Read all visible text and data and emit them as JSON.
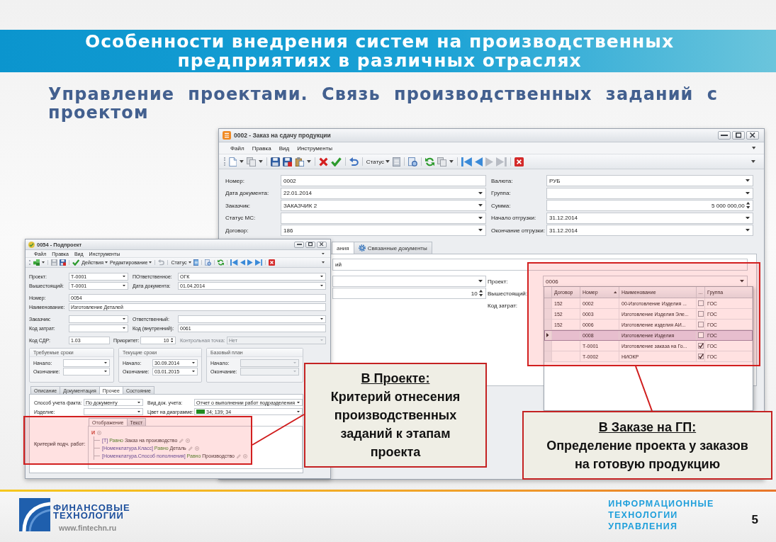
{
  "slide": {
    "title": "Особенности внедрения систем на производственных предприятиях в различных отраслях",
    "subtitle": "Управление проектами. Связь производственных заданий с проектом"
  },
  "order_window": {
    "title": "0002 - Заказ на сдачу продукции",
    "menu": [
      "Файл",
      "Правка",
      "Вид",
      "Инструменты"
    ],
    "toolbar": {
      "status_label": "Статус"
    },
    "fields_left": [
      {
        "label": "Номер:",
        "value": "0002",
        "kind": "text"
      },
      {
        "label": "Дата документа:",
        "value": "22.01.2014",
        "kind": "dropdown"
      },
      {
        "label": "Заказчик:",
        "value": "ЗАКАЗЧИК 2",
        "kind": "dropdown"
      },
      {
        "label": "Статус МС:",
        "kind": "dropdown"
      },
      {
        "label": "Договор:",
        "value": "186",
        "kind": "dropdown"
      }
    ],
    "fields_right": [
      {
        "label": "Валюта:",
        "value": "РУБ",
        "kind": "dropdown"
      },
      {
        "label": "Группа:",
        "kind": "dropdown"
      },
      {
        "label": "Сумма:",
        "value": "5 000 000,00",
        "kind": "spin"
      },
      {
        "label": "Начало отгрузки:",
        "value": "31.12.2014",
        "kind": "dropdown"
      },
      {
        "label": "Окончание отгрузки:",
        "value": "31.12.2014",
        "kind": "dropdown"
      }
    ],
    "tabs": [
      {
        "label": "ания",
        "selected": true
      },
      {
        "label": "Связанные документы",
        "selected": false
      }
    ],
    "tab_panel": {
      "wide_field": {
        "value": "ий",
        "kind": "text"
      },
      "left_fields": [
        {
          "kind": "dropdown"
        },
        {
          "value": "10",
          "kind": "spin"
        }
      ],
      "right_fields": [
        {
          "label": "Проект:",
          "value": "0006",
          "kind": "dropdown"
        },
        {
          "label": "Вышестоящий:"
        },
        {
          "label": "Код затрат:"
        }
      ]
    },
    "lookup": {
      "columns": [
        {
          "label": "Договор",
          "sorted": false
        },
        {
          "label": "Номер",
          "sorted": true
        },
        {
          "label": "Наименование",
          "sorted": false
        },
        {
          "label": "...",
          "sorted": false
        },
        {
          "label": "Группа",
          "sorted": false
        }
      ],
      "rows": [
        {
          "contract": "152",
          "number": "0002",
          "name": "00-Изготовление Изделия ...",
          "checked": false,
          "group": "ГОС",
          "selected": false
        },
        {
          "contract": "152",
          "number": "0003",
          "name": "Изготовление Изделия Эле...",
          "checked": false,
          "group": "ГОС",
          "selected": false
        },
        {
          "contract": "152",
          "number": "0006",
          "name": "Изготовление изделия АИ...",
          "checked": false,
          "group": "ГОС",
          "selected": false
        },
        {
          "number": "0008",
          "name": "Изготовление Изделия",
          "checked": false,
          "group": "ГОС",
          "selected": true
        },
        {
          "number": "Т-0001",
          "name": "Изготовление заказа на Го...",
          "checked": true,
          "group": "ГОС",
          "selected": false
        },
        {
          "number": "Т-0002",
          "name": "НИОКР",
          "checked": true,
          "group": "ГОС",
          "selected": false
        }
      ]
    }
  },
  "project_window": {
    "title": "0054 - Подпроект",
    "menu": [
      "Файл",
      "Правка",
      "Вид",
      "Инструменты"
    ],
    "toolbar": {
      "actions_label": "Действия",
      "edit_label": "Редактирование",
      "status_label": "Статус"
    },
    "header_rows": [
      [
        {
          "label": "Проект:",
          "value": "Т-0001",
          "kind": "dropdown",
          "disabled": false
        },
        {
          "label": "ПОтветственное:",
          "value": "ОГК",
          "kind": "dropdown",
          "disabled": false
        }
      ],
      [
        {
          "label": "Вышестоящий:",
          "value": "Т-0001",
          "kind": "dropdown",
          "disabled": false
        },
        {
          "label": "Дата документа:",
          "value": "01.04.2014",
          "kind": "dropdown",
          "disabled": false
        }
      ],
      [
        {
          "label": "Номер:",
          "value": "0054",
          "kind": "text",
          "disabled": false
        }
      ],
      [
        {
          "label": "Наименование:",
          "value": "Изготовление Деталей",
          "kind": "text",
          "disabled": false
        }
      ],
      [
        {
          "label": "Заказчик:",
          "kind": "dropdown",
          "disabled": false
        },
        {
          "label": "Ответственный:",
          "kind": "dropdown",
          "disabled": false
        }
      ],
      [
        {
          "label": "Код затрат:",
          "kind": "dropdown",
          "disabled": false
        },
        {
          "label": "Код (внутренний):",
          "value": "0061",
          "kind": "text",
          "disabled": false
        }
      ],
      [
        {
          "label": "Код СДР:",
          "value": "1.03",
          "kind": "text",
          "disabled": false
        },
        {
          "label": "Приоритет:",
          "value": "10",
          "kind": "spin",
          "disabled": false
        },
        {
          "label": "Контрольная точка:",
          "value": "Нет",
          "kind": "dropdown",
          "disabled": true
        }
      ]
    ],
    "date_groups": [
      {
        "title": "Требуемые сроки",
        "fields": [
          {
            "label": "Начало:",
            "kind": "dropdown",
            "disabled": false
          },
          {
            "label": "Окончание:",
            "kind": "dropdown",
            "disabled": false
          }
        ]
      },
      {
        "title": "Текущие сроки",
        "fields": [
          {
            "label": "Начало:",
            "value": "30.09.2014",
            "kind": "dropdown",
            "disabled": false
          },
          {
            "label": "Окончание:",
            "value": "03.01.2015",
            "kind": "dropdown",
            "disabled": false
          }
        ]
      },
      {
        "title": "Базовый план",
        "fields": [
          {
            "label": "Начало:",
            "kind": "dropdown",
            "disabled": true
          },
          {
            "label": "Окончание:",
            "kind": "dropdown",
            "disabled": true
          }
        ]
      }
    ],
    "tabs": [
      {
        "label": "Описание",
        "selected": false
      },
      {
        "label": "Документация",
        "selected": false
      },
      {
        "label": "Прочее",
        "selected": true
      },
      {
        "label": "Состояние",
        "selected": false
      }
    ],
    "tab_panel_rows": [
      [
        {
          "label": "Способ учета факта:",
          "value": "По документу",
          "kind": "dropdown",
          "disabled": false
        },
        {
          "label": "Вид док. учета:",
          "value": "Отчет о выполнении работ подразделения",
          "kind": "dropdown",
          "disabled": false
        }
      ],
      [
        {
          "label": "Изделие:",
          "kind": "dropdown",
          "disabled": false
        },
        {
          "label": "Цвет на диаграмме:",
          "value": "34; 139; 34",
          "kind": "color",
          "color": "#228b22",
          "disabled": false
        }
      ]
    ],
    "criteria": {
      "label": "Критерий подч. работ:",
      "tabs": [
        {
          "label": "Отображение",
          "selected": true
        },
        {
          "label": "Текст",
          "selected": false
        }
      ],
      "tree": {
        "operator": "И",
        "children": [
          {
            "field": "[Т]",
            "operator": "Равно",
            "value": "Заказ на производство"
          },
          {
            "field": "[Номенклатура.Класс]",
            "operator": "Равно",
            "value": "Деталь"
          },
          {
            "field": "[Номенклатура.Способ пополнения]",
            "operator": "Равно",
            "value": "Производство"
          }
        ]
      }
    }
  },
  "callouts": [
    {
      "heading": "В Проекте:",
      "text": "Критерий отнесения производственных заданий к этапам проекта"
    },
    {
      "heading": "В Заказе на ГП:",
      "text": "Определение проекта у заказов на готовую продукцию"
    }
  ],
  "footer": {
    "company_name": "ФИНАНСОВЫЕ ТЕХНОЛОГИИ",
    "website": "www.fintechn.ru",
    "tagline": "ИНФОРМАЦИОННЫЕ ТЕХНОЛОГИИ УПРАВЛЕНИЯ",
    "page_number": "5"
  }
}
